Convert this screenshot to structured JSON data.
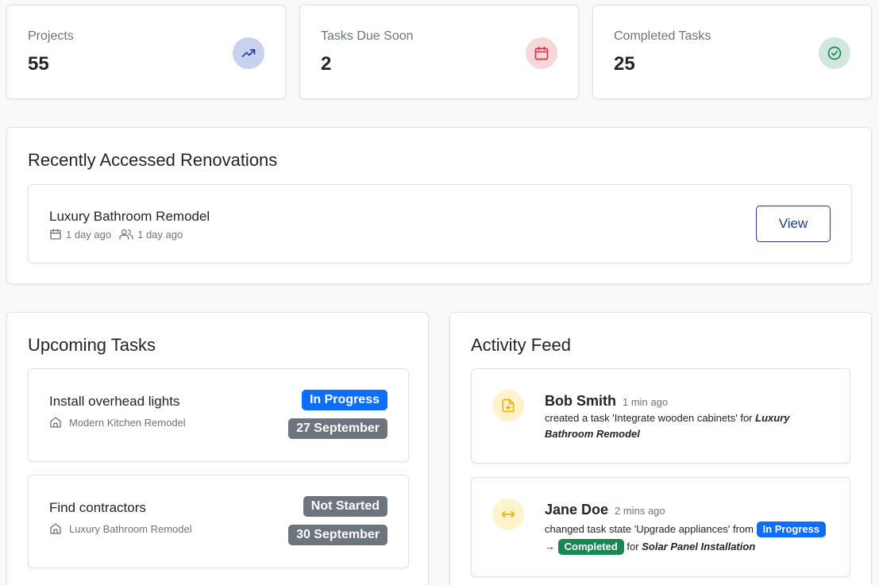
{
  "stats": [
    {
      "label": "Projects",
      "value": "55",
      "icon": "trending-up-icon",
      "icon_bg": "#c8d2f0",
      "icon_color": "#1d3b8f"
    },
    {
      "label": "Tasks Due Soon",
      "value": "2",
      "icon": "calendar-icon",
      "icon_bg": "#f8d7da",
      "icon_color": "#dc3545"
    },
    {
      "label": "Completed Tasks",
      "value": "25",
      "icon": "check-circle-icon",
      "icon_bg": "#d1e7dd",
      "icon_color": "#198754"
    }
  ],
  "recent": {
    "title": "Recently Accessed Renovations",
    "items": [
      {
        "name": "Luxury Bathroom Remodel",
        "updated": "1 day ago",
        "members": "1 day ago",
        "button": "View"
      }
    ]
  },
  "upcoming": {
    "title": "Upcoming Tasks",
    "tasks": [
      {
        "title": "Install overhead lights",
        "project": "Modern Kitchen Remodel",
        "status": "In Progress",
        "status_color": "#0d6efd",
        "date": "27 September"
      },
      {
        "title": "Find contractors",
        "project": "Luxury Bathroom Remodel",
        "status": "Not Started",
        "status_color": "#6c757d",
        "date": "30 September"
      }
    ],
    "date_color": "#6c757d"
  },
  "feed": {
    "title": "Activity Feed",
    "items": [
      {
        "user": "Bob Smith",
        "time": "1 min ago",
        "icon": "file-plus-icon",
        "text": "created a task 'Integrate wooden cabinets' for",
        "project": "Luxury Bathroom Remodel"
      },
      {
        "user": "Jane Doe",
        "time": "2 mins ago",
        "icon": "arrows-horizontal-icon",
        "text": "changed task state 'Upgrade appliances' from",
        "from_state": "In Progress",
        "from_color": "#0d6efd",
        "arrow": "→",
        "to_state": "Completed",
        "to_color": "#198754",
        "for_text": "for",
        "project": "Solar Panel Installation"
      }
    ]
  }
}
